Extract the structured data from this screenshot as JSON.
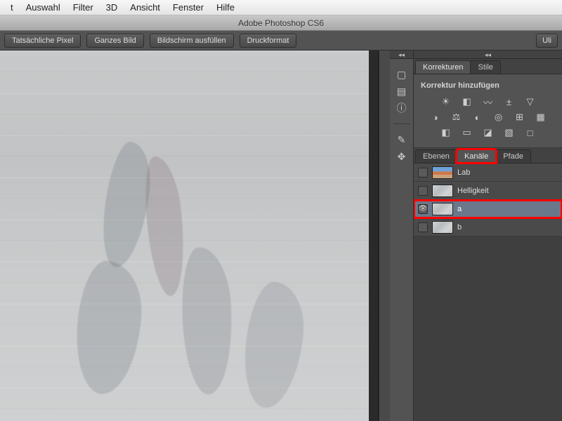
{
  "mac_menu": [
    "t",
    "Auswahl",
    "Filter",
    "3D",
    "Ansicht",
    "Fenster",
    "Hilfe"
  ],
  "app_title": "Adobe Photoshop CS6",
  "options_bar": {
    "buttons": [
      "Tatsächliche Pixel",
      "Ganzes Bild",
      "Bildschirm ausfüllen",
      "Druckformat"
    ],
    "user": "Uli"
  },
  "tool_strip": {
    "icons": [
      "histogram-icon",
      "swatches-icon",
      "info-icon"
    ],
    "icons2": [
      "brush-icon",
      "clone-icon"
    ]
  },
  "adjustments_panel": {
    "tabs": [
      "Korrekturen",
      "Stile"
    ],
    "active_tab": 0,
    "subhead": "Korrektur hinzufügen",
    "row1": [
      "brightness-icon",
      "levels-icon",
      "curves-icon",
      "exposure-icon",
      "vibrance-icon"
    ],
    "row2": [
      "huesat-icon",
      "colorbalance-icon",
      "bw-icon",
      "photofilter-icon",
      "channelmixer-icon",
      "colorlookup-icon"
    ],
    "row3": [
      "invert-icon",
      "posterize-icon",
      "threshold-icon",
      "gradientmap-icon",
      "selcolor-icon"
    ]
  },
  "channels_panel": {
    "tabs": [
      "Ebenen",
      "Kanäle",
      "Pfade"
    ],
    "active_tab": 1,
    "highlighted_tab": 1,
    "rows": [
      {
        "name": "Lab",
        "visible": false,
        "color_thumb": true,
        "selected": false,
        "highlighted": false
      },
      {
        "name": "Helligkeit",
        "visible": false,
        "color_thumb": false,
        "selected": false,
        "highlighted": false
      },
      {
        "name": "a",
        "visible": true,
        "color_thumb": false,
        "selected": true,
        "highlighted": true
      },
      {
        "name": "b",
        "visible": false,
        "color_thumb": false,
        "selected": false,
        "highlighted": false
      }
    ]
  },
  "glyphs": {
    "histogram-icon": "▢",
    "swatches-icon": "▤",
    "info-icon": "ⓘ",
    "brush-icon": "✎",
    "clone-icon": "✥",
    "brightness-icon": "☀",
    "levels-icon": "◧",
    "curves-icon": "〰",
    "exposure-icon": "±",
    "vibrance-icon": "▽",
    "huesat-icon": "◑",
    "colorbalance-icon": "⚖",
    "bw-icon": "◐",
    "photofilter-icon": "◎",
    "channelmixer-icon": "⊞",
    "colorlookup-icon": "▦",
    "invert-icon": "◧",
    "posterize-icon": "▭",
    "threshold-icon": "◪",
    "gradientmap-icon": "▧",
    "selcolor-icon": "□"
  }
}
